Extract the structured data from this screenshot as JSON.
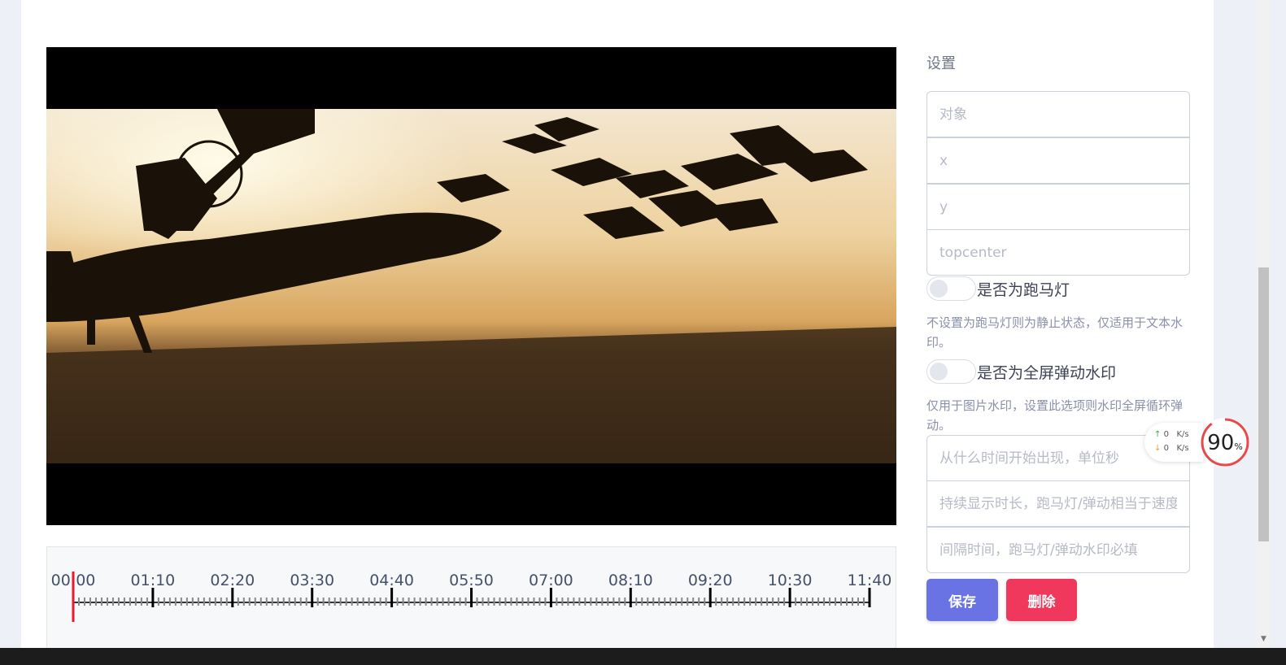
{
  "settings": {
    "title": "设置",
    "fields": {
      "object_placeholder": "对象",
      "x_placeholder": "x",
      "y_placeholder": "y",
      "position_placeholder": "topcenter",
      "start_time_placeholder": "从什么时间开始出现，单位秒",
      "duration_placeholder": "持续显示时长，跑马灯/弹动相当于速度",
      "interval_placeholder": "间隔时间，跑马灯/弹动水印必填"
    },
    "marquee_toggle": {
      "label": "是否为跑马灯",
      "on": false,
      "hint": "不设置为跑马灯则为静止状态，仅适用于文本水印。"
    },
    "bounce_toggle": {
      "label": "是否为全屏弹动水印",
      "on": false,
      "hint": "仅用于图片水印，设置此选项则水印全屏循环弹动。"
    },
    "save_label": "保存",
    "delete_label": "删除"
  },
  "timeline": {
    "tick_labels": [
      "00:00",
      "01:10",
      "02:20",
      "03:30",
      "04:40",
      "05:50",
      "07:00",
      "08:10",
      "09:20",
      "10:30",
      "11:40"
    ],
    "playhead": "00:00"
  },
  "net_monitor": {
    "upload": "0",
    "download": "0",
    "unit": "K/s",
    "percent": "90",
    "percent_sign": "%",
    "up_color": "#2bb24c",
    "down_color": "#f39a2a",
    "ring_color": "#e84a4a"
  },
  "colors": {
    "save": "#6a73e3",
    "delete": "#f0385c",
    "playhead": "#e8192c"
  }
}
